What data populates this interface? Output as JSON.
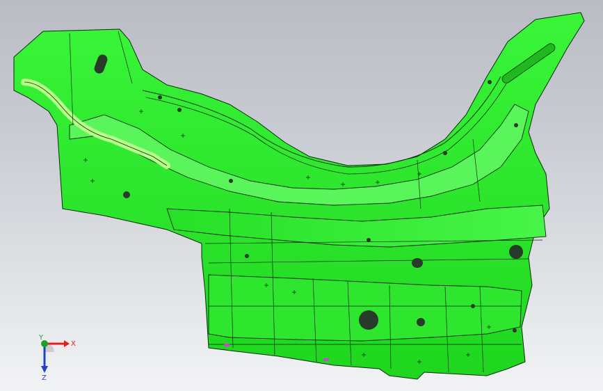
{
  "viewport": {
    "background_top": "#b9bcc3",
    "background_bottom": "#f2f3f5"
  },
  "model": {
    "part_color": "#22e622",
    "part_shadow": "#12b812",
    "part_highlight": "#b8ff8a",
    "edge_color": "#0a2a0a",
    "hole_color": "#2a3a2a",
    "accent_color": "#cc44cc"
  },
  "triad": {
    "x_label": "X",
    "y_label": "Y",
    "z_label": "Z",
    "x_color": "#e02020",
    "y_color": "#20a020",
    "z_color": "#2040d0"
  }
}
